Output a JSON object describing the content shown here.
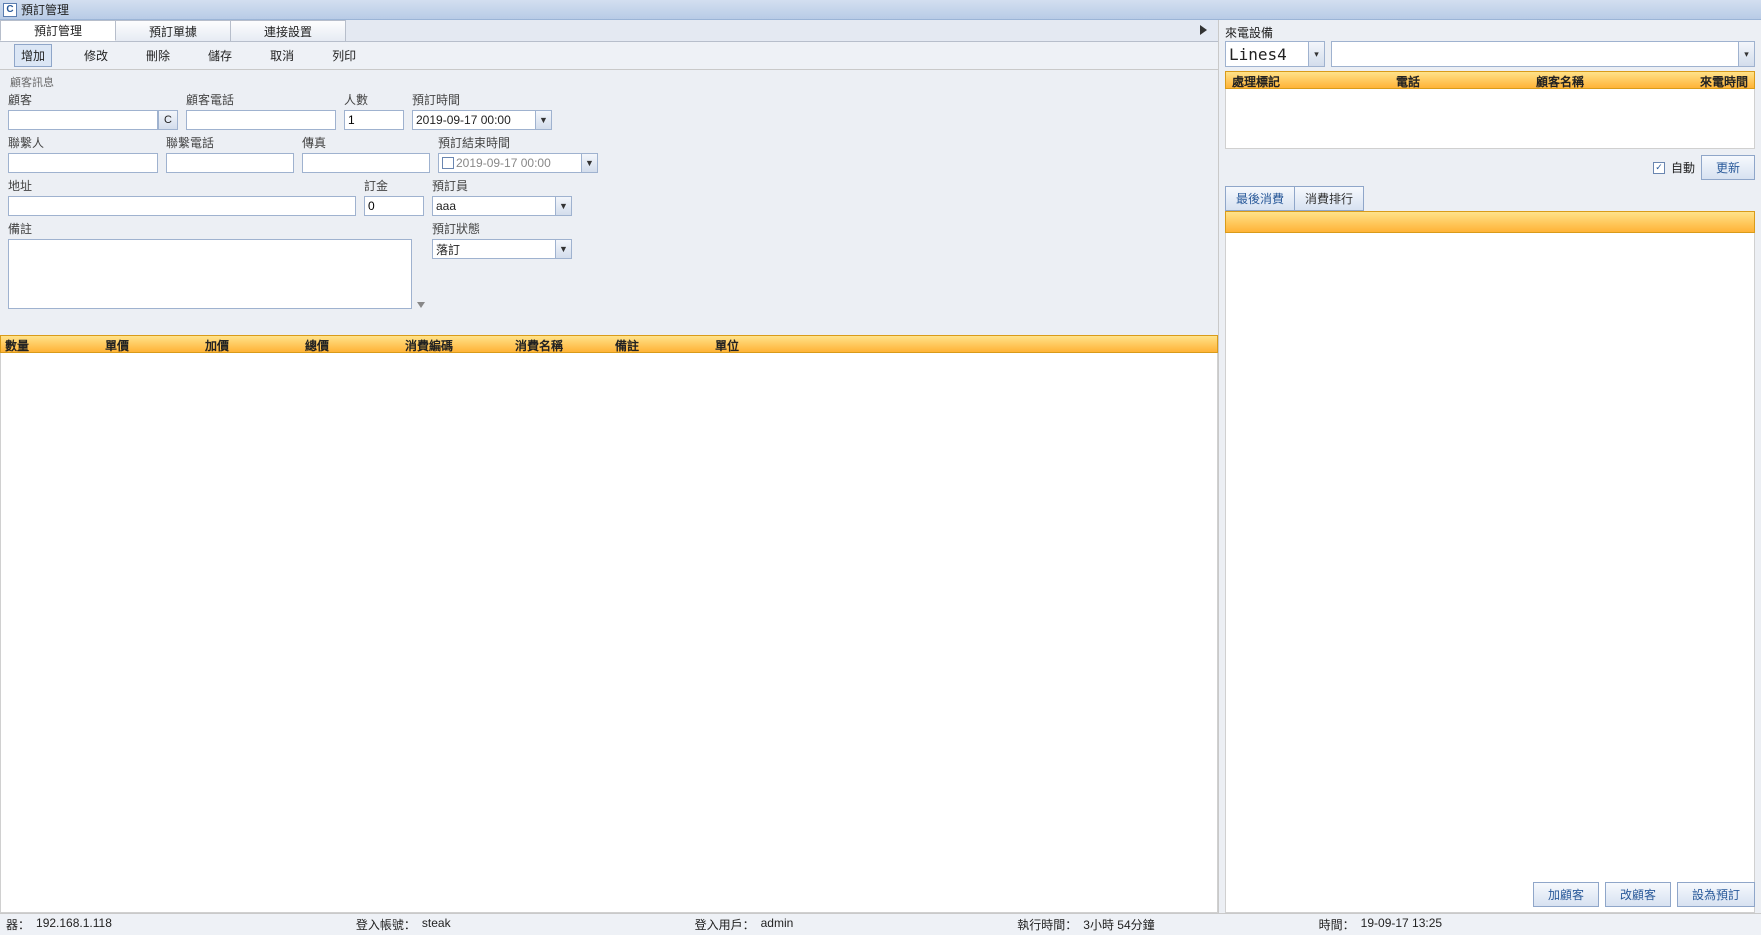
{
  "window": {
    "title": "預訂管理",
    "icon_letter": "C"
  },
  "tabs": {
    "t1": "預訂管理",
    "t2": "預訂單據",
    "t3": "連接設置"
  },
  "toolbar": {
    "add": "增加",
    "edit": "修改",
    "del": "刪除",
    "save": "儲存",
    "cancel": "取消",
    "print": "列印"
  },
  "form": {
    "section": "顧客訊息",
    "customer_lbl": "顧客",
    "customer": "",
    "c_btn": "C",
    "cphone_lbl": "顧客電話",
    "cphone": "",
    "people_lbl": "人數",
    "people": "1",
    "rtime_lbl": "預訂時間",
    "rtime": "2019-09-17 00:00",
    "contact_lbl": "聯繫人",
    "contact": "",
    "contactphone_lbl": "聯繫電話",
    "contactphone": "",
    "fax_lbl": "傳真",
    "fax": "",
    "retime_lbl": "預訂結束時間",
    "retime": "2019-09-17 00:00",
    "addr_lbl": "地址",
    "addr": "",
    "deposit_lbl": "訂金",
    "deposit": "0",
    "staff_lbl": "預訂員",
    "staff": "aaa",
    "memo_lbl": "備註",
    "memo": "",
    "status_lbl": "預訂狀態",
    "status": "落訂"
  },
  "grid_main": {
    "c1": "數量",
    "c2": "單價",
    "c3": "加價",
    "c4": "總價",
    "c5": "消費編碼",
    "c6": "消費名稱",
    "c7": "備註",
    "c8": "單位"
  },
  "side": {
    "device_lbl": "來電設備",
    "line": "Lines4",
    "grid": {
      "c1": "處理標記",
      "c2": "電話",
      "c3": "顧客名稱",
      "c4": "來電時間"
    },
    "auto_lbl": "自動",
    "auto_checked": true,
    "refresh": "更新",
    "tab1": "最後消費",
    "tab2": "消費排行",
    "btn_add": "加顧客",
    "btn_edit": "改顧客",
    "btn_set": "設為預訂"
  },
  "status": {
    "host_lbl": "器：",
    "host": "192.168.1.118",
    "acct_lbl": "登入帳號：",
    "acct": "steak",
    "user_lbl": "登入用戶：",
    "user": "admin",
    "run_lbl": "執行時間：",
    "run": "3小時 54分鐘",
    "time_lbl": "時間：",
    "time": "19-09-17 13:25"
  }
}
